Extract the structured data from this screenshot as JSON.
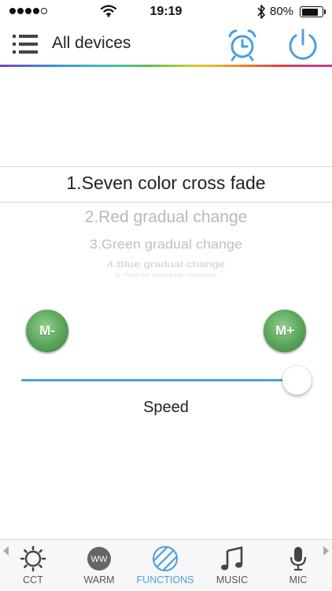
{
  "status_bar": {
    "time": "19:19",
    "battery_percent": "80%",
    "battery_level": 0.8,
    "signal_bars_filled": 4,
    "signal_bars_total": 5,
    "icons": [
      "signal-dots-icon",
      "wifi-icon",
      "bluetooth-icon",
      "battery-icon"
    ]
  },
  "nav": {
    "title": "All devices",
    "icons": [
      "menu-list-icon",
      "alarm-clock-icon",
      "power-icon"
    ]
  },
  "picker": {
    "selected": "1.Seven color cross fade",
    "items": [
      "2.Red  gradual change",
      "3.Green gradual change",
      "4.Blue gradual change",
      "5.Yellow gradual change"
    ]
  },
  "mode_buttons": {
    "minus_label": "M-",
    "plus_label": "M+"
  },
  "speed": {
    "label": "Speed",
    "value": 1.0
  },
  "tabs": [
    {
      "label": "CCT",
      "icon": "sun-gear-icon",
      "active": false
    },
    {
      "label": "WARM",
      "icon": "ww-circle-icon",
      "active": false
    },
    {
      "label": "FUNCTIONS",
      "icon": "striped-circle-icon",
      "active": true
    },
    {
      "label": "MUSIC",
      "icon": "music-note-icon",
      "active": false
    },
    {
      "label": "MIC",
      "icon": "microphone-icon",
      "active": false
    }
  ],
  "warm_icon_text": "WW",
  "colors": {
    "accent": "#4a9fdc",
    "button_green": "#5aa35a",
    "text": "#222222",
    "inactive_tab": "#555555"
  }
}
